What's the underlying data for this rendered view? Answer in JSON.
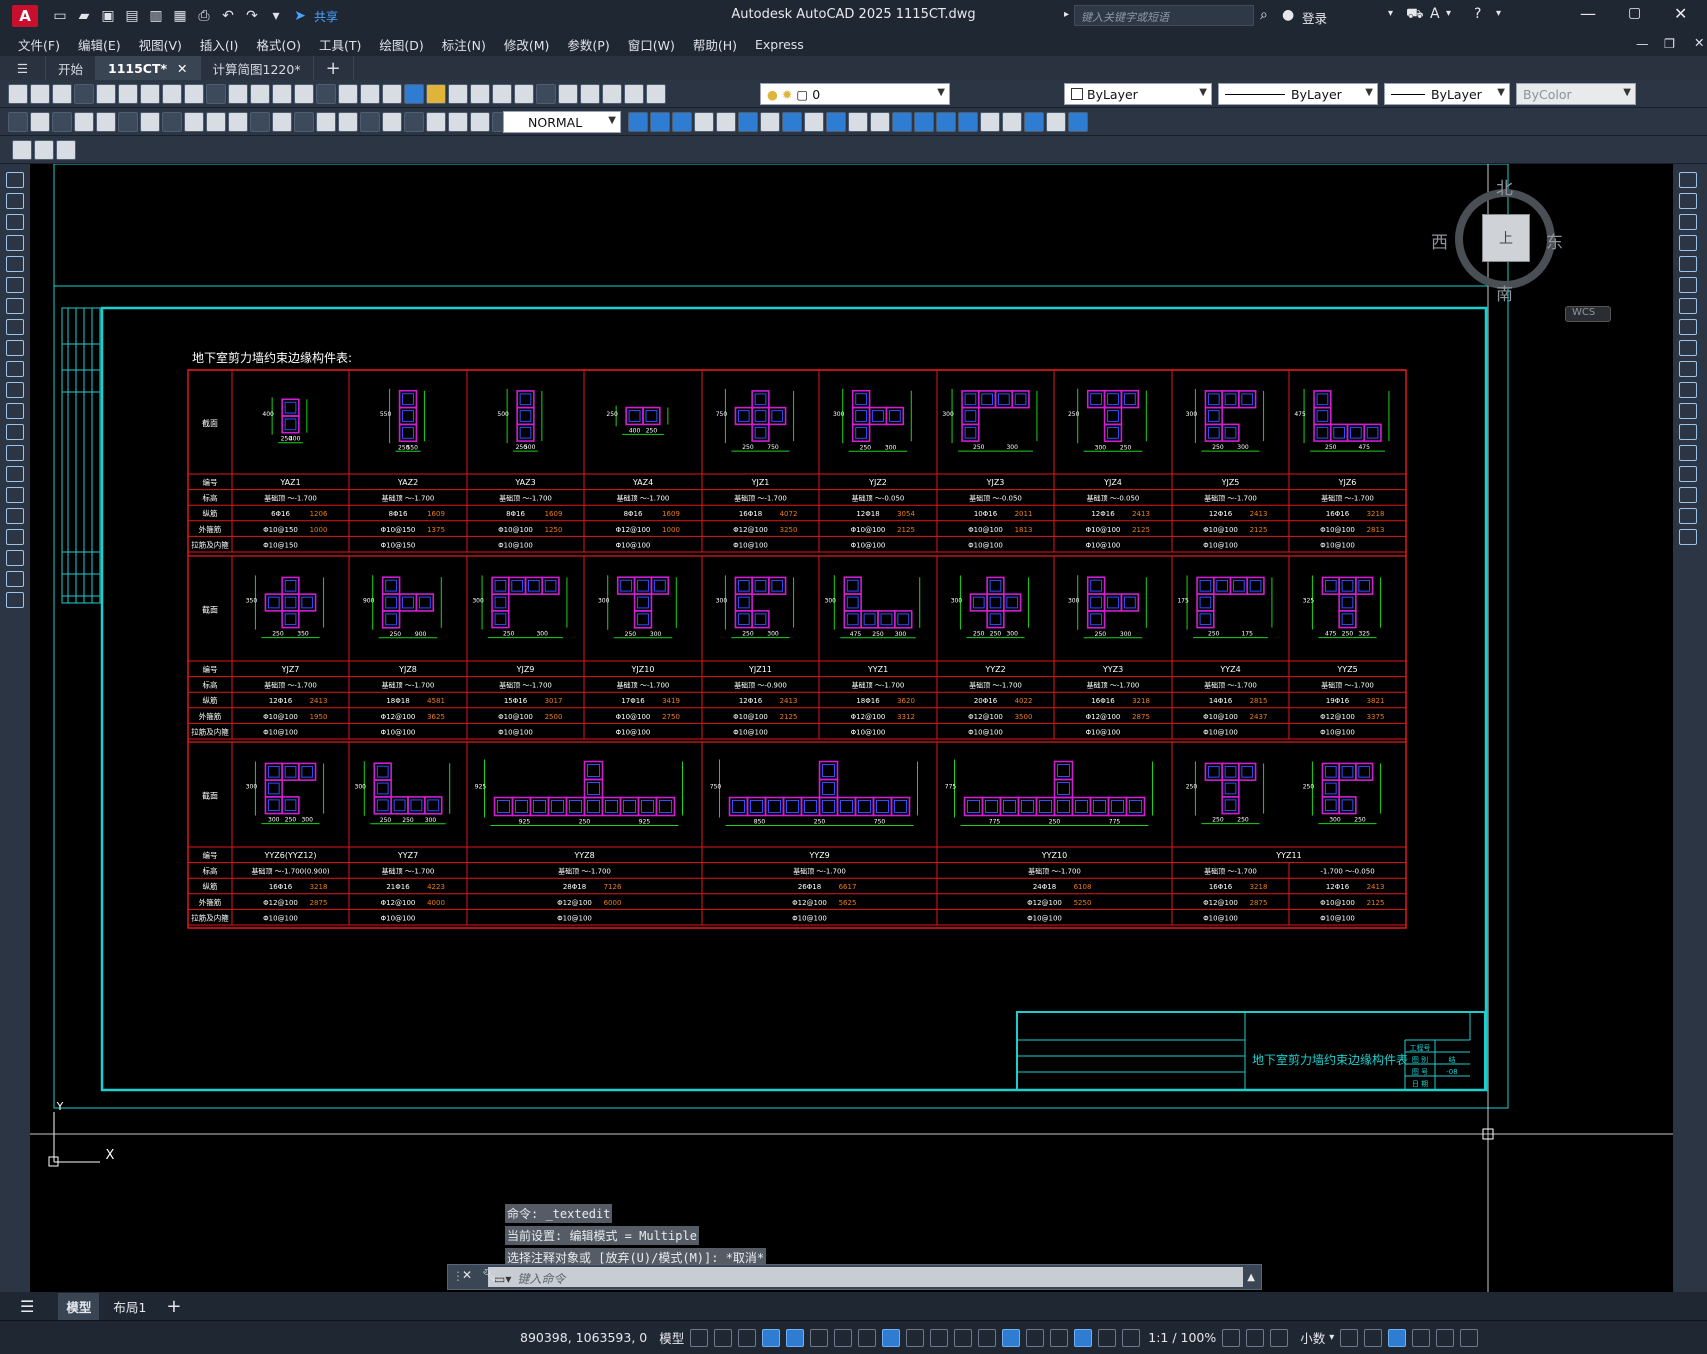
{
  "app": {
    "icon_letter": "A",
    "title": "Autodesk AutoCAD 2025    1115CT.dwg",
    "share_label": "共享",
    "search_placeholder": "键入关键字或短语",
    "login_label": "登录"
  },
  "menu": [
    "文件(F)",
    "编辑(E)",
    "视图(V)",
    "插入(I)",
    "格式(O)",
    "工具(T)",
    "绘图(D)",
    "标注(N)",
    "修改(M)",
    "参数(P)",
    "窗口(W)",
    "帮助(H)",
    "Express"
  ],
  "tabs": [
    {
      "label": "开始",
      "active": false
    },
    {
      "label": "1115CT*",
      "active": true
    },
    {
      "label": "计算简图1220*",
      "active": false
    }
  ],
  "toolbar": {
    "layer_name": "0",
    "color": "ByLayer",
    "linetype": "ByLayer",
    "lineweight": "ByLayer",
    "plotstyle": "ByColor",
    "text_style": "NORMAL"
  },
  "viewcube": {
    "north": "北",
    "south": "南",
    "east": "东",
    "west": "西",
    "center": "上",
    "wcs": "WCS"
  },
  "drawing": {
    "table_title": "地下室剪力墙约束边缘构件表:",
    "titleblock_name": "地下室剪力墙约束边缘构件表",
    "titleblock_fields": [
      "工程号",
      "图 别",
      "图 号",
      "日 期"
    ],
    "titleblock_values": [
      "",
      "结",
      "-08",
      ""
    ],
    "row_labels": [
      "截面",
      "编号",
      "标高",
      "纵筋",
      "外箍筋",
      "拉筋及内箍"
    ],
    "rows": [
      {
        "cols": [
          {
            "id": "YAZ1",
            "elev": "基础顶 ～-1.700",
            "main": "6Φ16",
            "main_area": "1206",
            "hoop": "Φ10@150",
            "hoop_len": "1000",
            "tie": "Φ10@150",
            "dims": [
              "250",
              "400"
            ]
          },
          {
            "id": "YAZ2",
            "elev": "基础顶 ～-1.700",
            "main": "8Φ16",
            "main_area": "1609",
            "hoop": "Φ10@150",
            "hoop_len": "1375",
            "tie": "Φ10@150",
            "dims": [
              "250",
              "550"
            ]
          },
          {
            "id": "YAZ3",
            "elev": "基础顶 ～-1.700",
            "main": "8Φ16",
            "main_area": "1609",
            "hoop": "Φ10@100",
            "hoop_len": "1250",
            "tie": "Φ10@100",
            "dims": [
              "250",
              "500"
            ]
          },
          {
            "id": "YAZ4",
            "elev": "基础顶 ～-1.700",
            "main": "8Φ16",
            "main_area": "1609",
            "hoop": "Φ12@100",
            "hoop_len": "1000",
            "tie": "Φ10@100",
            "dims": [
              "400",
              "250"
            ]
          },
          {
            "id": "YJZ1",
            "elev": "基础顶 ～-1.700",
            "main": "16Φ18",
            "main_area": "4072",
            "hoop": "Φ12@100",
            "hoop_len": "3250",
            "tie": "Φ10@100",
            "dims": [
              "250",
              "750"
            ]
          },
          {
            "id": "YJZ2",
            "elev": "基础顶 ～-0.050",
            "main": "12Φ18",
            "main_area": "3054",
            "hoop": "Φ10@100",
            "hoop_len": "2125",
            "tie": "Φ10@100",
            "dims": [
              "250",
              "300"
            ]
          },
          {
            "id": "YJZ3",
            "elev": "基础顶 ～-0.050",
            "main": "10Φ16",
            "main_area": "2011",
            "hoop": "Φ10@100",
            "hoop_len": "1813",
            "tie": "Φ10@100",
            "dims": [
              "250",
              "300"
            ]
          },
          {
            "id": "YJZ4",
            "elev": "基础顶 ～-0.050",
            "main": "12Φ16",
            "main_area": "2413",
            "hoop": "Φ10@100",
            "hoop_len": "2125",
            "tie": "Φ10@100",
            "dims": [
              "300",
              "250"
            ]
          },
          {
            "id": "YJZ5",
            "elev": "基础顶 ～-1.700",
            "main": "12Φ16",
            "main_area": "2413",
            "hoop": "Φ10@100",
            "hoop_len": "2125",
            "tie": "Φ10@100",
            "dims": [
              "250",
              "300"
            ]
          },
          {
            "id": "YJZ6",
            "elev": "基础顶 ～-1.700",
            "main": "16Φ16",
            "main_area": "3218",
            "hoop": "Φ10@100",
            "hoop_len": "2813",
            "tie": "Φ10@100",
            "dims": [
              "250",
              "475"
            ]
          }
        ]
      },
      {
        "cols": [
          {
            "id": "YJZ7",
            "elev": "基础顶 ～-1.700",
            "main": "12Φ16",
            "main_area": "2413",
            "hoop": "Φ10@100",
            "hoop_len": "1950",
            "tie": "Φ10@100",
            "dims": [
              "250",
              "350"
            ]
          },
          {
            "id": "YJZ8",
            "elev": "基础顶 ～-1.700",
            "main": "18Φ18",
            "main_area": "4581",
            "hoop": "Φ12@100",
            "hoop_len": "3625",
            "tie": "Φ10@100",
            "dims": [
              "250",
              "900"
            ]
          },
          {
            "id": "YJZ9",
            "elev": "基础顶 ～-1.700",
            "main": "15Φ16",
            "main_area": "3017",
            "hoop": "Φ10@100",
            "hoop_len": "2500",
            "tie": "Φ10@100",
            "dims": [
              "250",
              "300"
            ]
          },
          {
            "id": "YJZ10",
            "elev": "基础顶 ～-1.700",
            "main": "17Φ16",
            "main_area": "3419",
            "hoop": "Φ10@100",
            "hoop_len": "2750",
            "tie": "Φ10@100",
            "dims": [
              "250",
              "300"
            ]
          },
          {
            "id": "YJZ11",
            "elev": "基础顶 ～-0.900",
            "main": "12Φ16",
            "main_area": "2413",
            "hoop": "Φ10@100",
            "hoop_len": "2125",
            "tie": "Φ10@100",
            "dims": [
              "250",
              "300"
            ]
          },
          {
            "id": "YYZ1",
            "elev": "基础顶 ～-1.700",
            "main": "18Φ16",
            "main_area": "3620",
            "hoop": "Φ12@100",
            "hoop_len": "3312",
            "tie": "Φ10@100",
            "dims": [
              "475",
              "250",
              "300"
            ]
          },
          {
            "id": "YYZ2",
            "elev": "基础顶 ～-1.700",
            "main": "20Φ16",
            "main_area": "4022",
            "hoop": "Φ12@100",
            "hoop_len": "3500",
            "tie": "Φ10@100",
            "dims": [
              "250",
              "250",
              "300"
            ]
          },
          {
            "id": "YYZ3",
            "elev": "基础顶 ～-1.700",
            "main": "16Φ16",
            "main_area": "3218",
            "hoop": "Φ12@100",
            "hoop_len": "2875",
            "tie": "Φ10@100",
            "dims": [
              "250",
              "300"
            ]
          },
          {
            "id": "YYZ4",
            "elev": "基础顶 ～-1.700",
            "main": "14Φ16",
            "main_area": "2815",
            "hoop": "Φ10@100",
            "hoop_len": "2437",
            "tie": "Φ10@100",
            "dims": [
              "250",
              "175"
            ]
          },
          {
            "id": "YYZ5",
            "elev": "基础顶 ～-1.700",
            "main": "19Φ16",
            "main_area": "3821",
            "hoop": "Φ12@100",
            "hoop_len": "3375",
            "tie": "Φ10@100",
            "dims": [
              "475",
              "250",
              "325"
            ]
          }
        ]
      },
      {
        "cols": [
          {
            "id": "YYZ6(YYZ12)",
            "elev": "基础顶 ～-1.700(0.900)",
            "main": "16Φ16",
            "main_area": "3218",
            "hoop": "Φ12@100",
            "hoop_len": "2875",
            "tie": "Φ10@100",
            "span": 1,
            "dims": [
              "300",
              "250",
              "300"
            ]
          },
          {
            "id": "YYZ7",
            "elev": "基础顶 ～-1.700",
            "main": "21Φ16",
            "main_area": "4223",
            "hoop": "Φ12@100",
            "hoop_len": "4000",
            "tie": "Φ10@100",
            "span": 1,
            "dims": [
              "250",
              "250",
              "300"
            ]
          },
          {
            "id": "YYZ8",
            "elev": "基础顶 ～-1.700",
            "main": "28Φ18",
            "main_area": "7126",
            "hoop": "Φ12@100",
            "hoop_len": "6000",
            "tie": "Φ10@100",
            "span": 2,
            "dims": [
              "925",
              "250",
              "925"
            ]
          },
          {
            "id": "YYZ9",
            "elev": "基础顶 ～-1.700",
            "main": "26Φ18",
            "main_area": "6617",
            "hoop": "Φ12@100",
            "hoop_len": "5625",
            "tie": "Φ10@100",
            "span": 2,
            "dims": [
              "850",
              "250",
              "750"
            ]
          },
          {
            "id": "YYZ10",
            "elev": "基础顶 ～-1.700",
            "main": "24Φ18",
            "main_area": "6108",
            "hoop": "Φ12@100",
            "hoop_len": "5250",
            "tie": "Φ10@100",
            "span": 2,
            "dims": [
              "775",
              "250",
              "775"
            ]
          },
          {
            "id": "YYZ11",
            "elev": "-1.700 ～-0.050",
            "main": "12Φ16",
            "main_area": "2413",
            "hoop": "Φ10@100",
            "hoop_len": "2125",
            "tie": "Φ10@100",
            "span": 1,
            "dims": [
              "300",
              "250"
            ]
          },
          {
            "id": "YYZ11",
            "elev": "基础顶 ～-1.700",
            "main": "16Φ16",
            "main_area": "3218",
            "hoop": "Φ12@100",
            "hoop_len": "2875",
            "tie": "Φ10@100",
            "span": 1,
            "dims": [
              "250",
              "250"
            ]
          }
        ]
      }
    ]
  },
  "command": {
    "history": [
      "命令: _textedit",
      "当前设置: 编辑模式 = Multiple",
      "选择注释对象或 [放弃(U)/模式(M)]: *取消*"
    ],
    "placeholder": "键入命令"
  },
  "layouts": [
    "模型",
    "布局1"
  ],
  "status": {
    "coords": "890398, 1063593, 0",
    "model_label": "模型",
    "scale": "1:1 / 100%",
    "units": "小数"
  },
  "colors": {
    "grid_red": "#e0191b",
    "border_cyan": "#1ccfcf",
    "section_magenta": "#d01ed0",
    "section_blue": "#3050ff",
    "dim_green": "#19d419",
    "area_orange": "#f07a1a"
  }
}
